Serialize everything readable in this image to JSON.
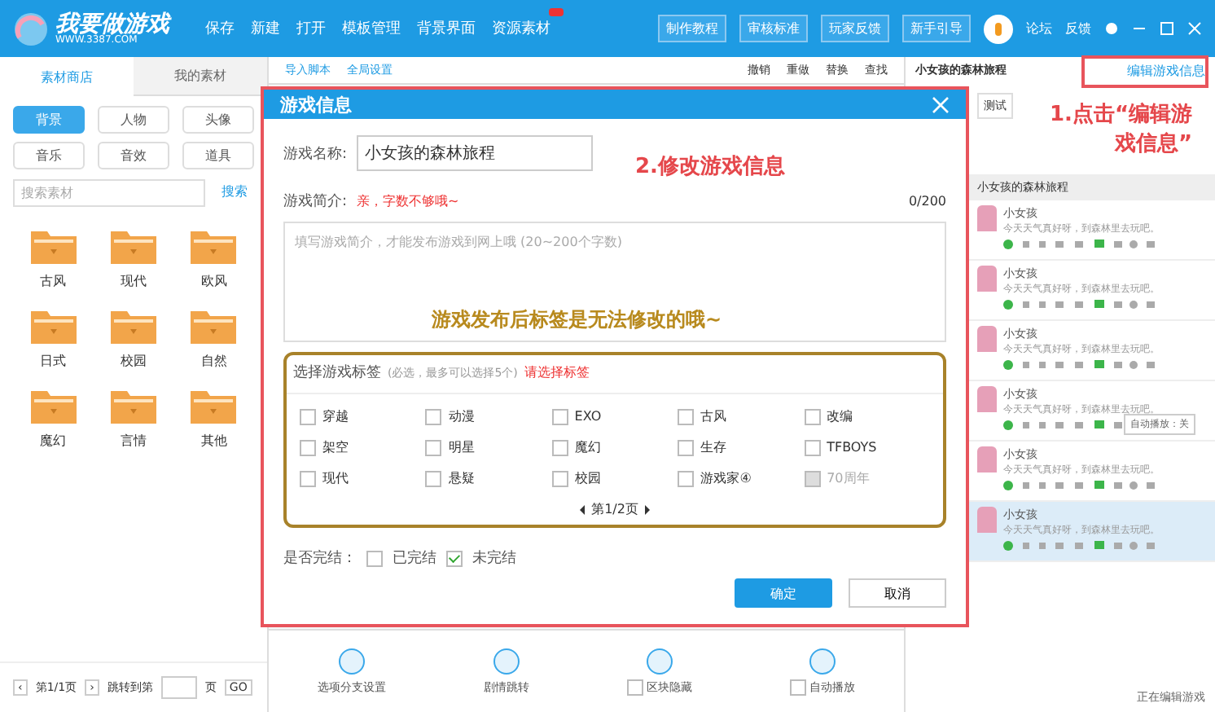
{
  "app": {
    "logo_text": "我要做游戏",
    "logo_url": "WWW.3387.COM"
  },
  "top_menu": [
    {
      "label": "保存",
      "badge": false
    },
    {
      "label": "新建",
      "badge": false
    },
    {
      "label": "打开",
      "badge": false
    },
    {
      "label": "模板管理",
      "badge": false
    },
    {
      "label": "背景界面",
      "badge": false
    },
    {
      "label": "资源素材",
      "badge": true
    }
  ],
  "top_buttons": [
    "制作教程",
    "审核标准",
    "玩家反馈",
    "新手引导"
  ],
  "user_links": [
    "论坛",
    "反馈"
  ],
  "left_panel": {
    "tabs": [
      {
        "label": "素材商店",
        "selected": true
      },
      {
        "label": "我的素材",
        "selected": false
      }
    ],
    "categories": [
      {
        "label": "背景",
        "selected": true
      },
      {
        "label": "人物",
        "selected": false
      },
      {
        "label": "头像",
        "selected": false
      },
      {
        "label": "音乐",
        "selected": false
      },
      {
        "label": "音效",
        "selected": false
      },
      {
        "label": "道具",
        "selected": false
      }
    ],
    "search": {
      "placeholder": "搜索素材",
      "button": "搜索"
    },
    "folders": [
      "古风",
      "现代",
      "欧风",
      "日式",
      "校园",
      "自然",
      "魔幻",
      "言情",
      "其他"
    ],
    "pager": {
      "prev": "‹",
      "next": "›",
      "page": "第1/1页",
      "jump": "跳转到第",
      "unit": "页",
      "go": "GO"
    }
  },
  "center": {
    "links": [
      "导入脚本",
      "全局设置"
    ],
    "tools": [
      "撤销",
      "重做",
      "替换",
      "查找"
    ],
    "bottom_tools": [
      {
        "label": "选项分支设置",
        "kind": "plain"
      },
      {
        "label": "剧情跳转",
        "kind": "plain"
      },
      {
        "label": "区块隐藏",
        "kind": "check",
        "checked": false
      },
      {
        "label": "自动播放",
        "kind": "check",
        "checked": false
      }
    ]
  },
  "right_panel": {
    "title": "小女孩的森林旅程",
    "edit_button": "编辑游戏信息",
    "test_button": "测试",
    "section": "小女孩的森林旅程",
    "messages": [
      {
        "name": "小女孩",
        "text": "今天天气真好呀，到森林里去玩吧。",
        "selected": false
      },
      {
        "name": "小女孩",
        "text": "今天天气真好呀，到森林里去玩吧。",
        "selected": false
      },
      {
        "name": "小女孩",
        "text": "今天天气真好呀，到森林里去玩吧。",
        "selected": false
      },
      {
        "name": "小女孩",
        "text": "今天天气真好呀，到森林里去玩吧。",
        "selected": false
      },
      {
        "name": "小女孩",
        "text": "今天天气真好呀，到森林里去玩吧。",
        "selected": false
      },
      {
        "name": "小女孩",
        "text": "今天天气真好呀，到森林里去玩吧。",
        "selected": true
      }
    ],
    "tooltip": "自动播放：关",
    "footer": "正在编辑游戏"
  },
  "dialog": {
    "title": "游戏信息",
    "name_label": "游戏名称:",
    "name_value": "小女孩的森林旅程",
    "intro_label": "游戏简介:",
    "intro_warning": "亲，字数不够哦~",
    "count": "0/200",
    "intro_placeholder": "填写游戏简介，才能发布游戏到网上哦 (20~200个字数)",
    "tag_label": "选择游戏标签",
    "tag_hint": "(必选，最多可以选择5个)",
    "tag_warning": "请选择标签",
    "tags": [
      {
        "label": "穿越",
        "checked": false,
        "disabled": false
      },
      {
        "label": "动漫",
        "checked": false,
        "disabled": false
      },
      {
        "label": "EXO",
        "checked": false,
        "disabled": false
      },
      {
        "label": "古风",
        "checked": false,
        "disabled": false
      },
      {
        "label": "改编",
        "checked": false,
        "disabled": false
      },
      {
        "label": "架空",
        "checked": false,
        "disabled": false
      },
      {
        "label": "明星",
        "checked": false,
        "disabled": false
      },
      {
        "label": "魔幻",
        "checked": false,
        "disabled": false
      },
      {
        "label": "生存",
        "checked": false,
        "disabled": false
      },
      {
        "label": "TFBOYS",
        "checked": false,
        "disabled": false
      },
      {
        "label": "现代",
        "checked": false,
        "disabled": false
      },
      {
        "label": "悬疑",
        "checked": false,
        "disabled": false
      },
      {
        "label": "校园",
        "checked": false,
        "disabled": false
      },
      {
        "label": "游戏家④",
        "checked": false,
        "disabled": false
      },
      {
        "label": "70周年",
        "checked": false,
        "disabled": true
      }
    ],
    "tag_page": "第1/2页",
    "finish_label": "是否完结：",
    "finish_options": [
      {
        "label": "已完结",
        "checked": false
      },
      {
        "label": "未完结",
        "checked": true
      }
    ],
    "ok": "确定",
    "cancel": "取消"
  },
  "annotations": {
    "step1": "1.点击“编辑游戏信息”",
    "step2": "2.修改游戏信息",
    "tag_note": "游戏发布后标签是无法修改的哦~"
  }
}
